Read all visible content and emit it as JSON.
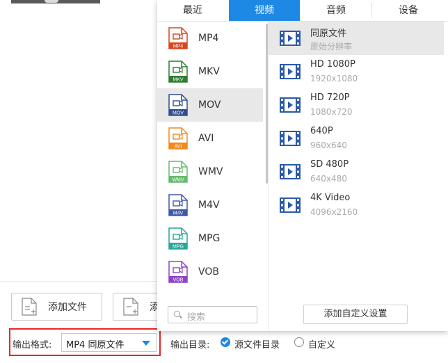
{
  "tabs": [
    {
      "label": "最近"
    },
    {
      "label": "视频"
    },
    {
      "label": "音频"
    },
    {
      "label": "设备"
    }
  ],
  "active_tab": "视频",
  "formats": [
    {
      "name": "MP4",
      "badge": "MP4",
      "color": "#d9451f"
    },
    {
      "name": "MKV",
      "badge": "MKV",
      "color": "#2e7d32"
    },
    {
      "name": "MOV",
      "badge": "MOV",
      "color": "#2f4f8f"
    },
    {
      "name": "AVI",
      "badge": "AVI",
      "color": "#f08a1c"
    },
    {
      "name": "WMV",
      "badge": "WMV",
      "color": "#66bb6a"
    },
    {
      "name": "M4V",
      "badge": "M4V",
      "color": "#3f5aa8"
    },
    {
      "name": "MPG",
      "badge": "MPG",
      "color": "#26a69a"
    },
    {
      "name": "VOB",
      "badge": "VOB",
      "color": "#8e44c8"
    }
  ],
  "selected_format": "MOV",
  "resolutions": [
    {
      "name": "同原文件",
      "sub": "原始分辨率"
    },
    {
      "name": "HD 1080P",
      "sub": "1920x1080"
    },
    {
      "name": "HD 720P",
      "sub": "1080x720"
    },
    {
      "name": "640P",
      "sub": "960x640"
    },
    {
      "name": "SD 480P",
      "sub": "640x480"
    },
    {
      "name": "4K Video",
      "sub": "4096x2160"
    }
  ],
  "search_placeholder": "搜索",
  "custom_button": "添加自定义设置",
  "toolbar": {
    "add_file": "添加文件",
    "add_folder_partial": "添"
  },
  "output_format": {
    "label": "输出格式:",
    "value": "MP4 同原文件"
  },
  "output_dir": {
    "label": "输出目录:",
    "option_source": "源文件目录",
    "option_custom": "自定义"
  },
  "colors": {
    "accent": "#1e88e5",
    "highlight_border": "#e8262b"
  }
}
